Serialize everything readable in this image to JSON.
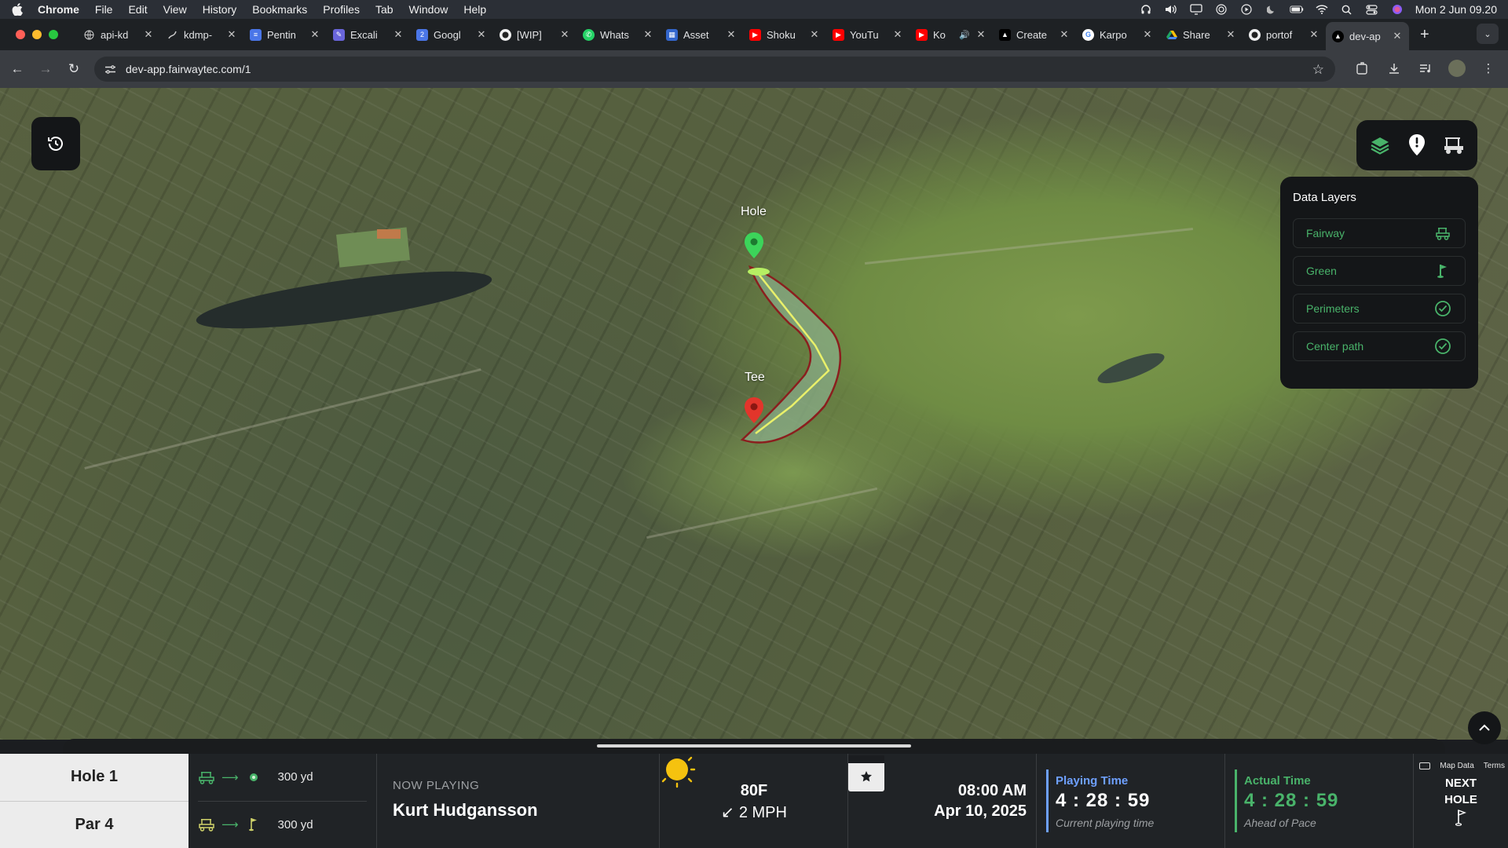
{
  "menubar": {
    "app_name": "Chrome",
    "menus": [
      "File",
      "Edit",
      "View",
      "History",
      "Bookmarks",
      "Profiles",
      "Tab",
      "Window",
      "Help"
    ],
    "clock": "Mon 2 Jun  09.20"
  },
  "browser": {
    "tabs": [
      {
        "title": "api-kd",
        "icon": "globe-icon",
        "color": "#8e9196"
      },
      {
        "title": "kdmp-",
        "icon": "route-icon",
        "color": "#8e9196"
      },
      {
        "title": "Pentin",
        "icon": "doc-icon",
        "color": "#4a76e8"
      },
      {
        "title": "Excali",
        "icon": "excalidraw-icon",
        "color": "#6965db"
      },
      {
        "title": "Googl",
        "icon": "google-docs-icon",
        "color": "#4a76e8"
      },
      {
        "title": "[WIP]",
        "icon": "github-icon",
        "color": "#2b2e32"
      },
      {
        "title": "Whats",
        "icon": "whatsapp-icon",
        "color": "#25d366"
      },
      {
        "title": "Asset",
        "icon": "asset-icon",
        "color": "#3366cc"
      },
      {
        "title": "Shoku",
        "icon": "youtube-icon",
        "color": "#ff0000"
      },
      {
        "title": "YouTu",
        "icon": "youtube-icon",
        "color": "#ff0000"
      },
      {
        "title": "Ko",
        "icon": "youtube-icon",
        "color": "#ff0000"
      },
      {
        "title": "Create",
        "icon": "vercel-icon",
        "color": "#000000"
      },
      {
        "title": "Karpo",
        "icon": "google-icon",
        "color": "#ffffff"
      },
      {
        "title": "Share",
        "icon": "drive-icon",
        "color": "#1fa463"
      },
      {
        "title": "portof",
        "icon": "github-icon",
        "color": "#2b2e32"
      },
      {
        "title": "dev-ap",
        "icon": "vercel-icon",
        "color": "#000000",
        "active": true
      }
    ],
    "url": "dev-app.fairwaytec.com/1"
  },
  "map": {
    "hole_label": "Hole",
    "tee_label": "Tee",
    "fairway_color": "#e9f06a",
    "perimeter_color": "#8b1e1e",
    "attribution": {
      "map_data": "Map Data",
      "terms": "Terms"
    }
  },
  "data_layers": {
    "title": "Data Layers",
    "items": [
      {
        "label": "Fairway",
        "icon": "golf-cart-icon"
      },
      {
        "label": "Green",
        "icon": "flag-icon"
      },
      {
        "label": "Perimeters",
        "icon": "check-circle-icon"
      },
      {
        "label": "Center path",
        "icon": "check-circle-icon"
      }
    ],
    "accent": "#49b36a"
  },
  "bottom_bar": {
    "hole": "Hole 1",
    "par": "Par 4",
    "yardage": [
      {
        "value": "300 yd",
        "target": "green-dot-icon"
      },
      {
        "value": "300 yd",
        "target": "flag-icon"
      }
    ],
    "now_playing_label": "NOW PLAYING",
    "player_name": "Kurt Hudgansson",
    "temperature": "80F",
    "wind": "2 MPH",
    "time": "08:00 AM",
    "date": "Apr 10, 2025",
    "playing_time": {
      "label": "Playing Time",
      "value": "4 : 28 : 59",
      "sub": "Current playing time",
      "color": "#6ea0ff"
    },
    "actual_time": {
      "label": "Actual Time",
      "value": "4 : 28 : 59",
      "sub": "Ahead of Pace",
      "color": "#49b36a"
    },
    "next_hole_line1": "NEXT",
    "next_hole_line2": "HOLE"
  }
}
